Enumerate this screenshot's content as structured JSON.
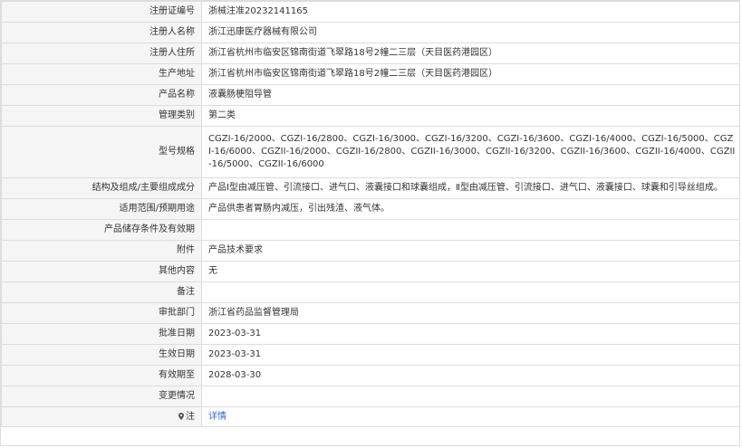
{
  "rows": [
    {
      "label": "注册证编号",
      "value": "浙械注准20232141165"
    },
    {
      "label": "注册人名称",
      "value": "浙江迅康医疗器械有限公司"
    },
    {
      "label": "注册人住所",
      "value": "浙江省杭州市临安区锦南街道飞翠路18号2幢二三层（天目医药港园区）"
    },
    {
      "label": "生产地址",
      "value": "浙江省杭州市临安区锦南街道飞翠路18号2幢二三层（天目医药港园区）"
    },
    {
      "label": "产品名称",
      "value": "液囊肠梗阻导管"
    },
    {
      "label": "管理类别",
      "value": "第二类"
    },
    {
      "label": "型号规格",
      "value": "CGZI-16/2000、CGZI-16/2800、CGZI-16/3000、CGZI-16/3200、CGZI-16/3600、CGZI-16/4000、CGZI-16/5000、CGZI-16/6000、CGZII-16/2000、CGZII-16/2800、CGZII-16/3000、CGZII-16/3200、CGZII-16/3600、CGZII-16/4000、CGZII-16/5000、CGZII-16/6000"
    },
    {
      "label": "结构及组成/主要组成成分",
      "value": "产品Ⅰ型由减压管、引流接口、进气口、液囊接口和球囊组成，Ⅱ型由减压管、引流接口、进气口、液囊接口、球囊和引导丝组成。"
    },
    {
      "label": "适用范围/预期用途",
      "value": "产品供患者胃肠内减压，引出残渣、液气体。"
    },
    {
      "label": "产品储存条件及有效期",
      "value": ""
    },
    {
      "label": "附件",
      "value": "产品技术要求"
    },
    {
      "label": "其他内容",
      "value": "无"
    },
    {
      "label": "备注",
      "value": ""
    },
    {
      "label": "审批部门",
      "value": "浙江省药品监督管理局"
    },
    {
      "label": "批准日期",
      "value": "2023-03-31"
    },
    {
      "label": "生效日期",
      "value": "2023-03-31"
    },
    {
      "label": "有效期至",
      "value": "2028-03-30"
    },
    {
      "label": "变更情况",
      "value": ""
    }
  ],
  "note_row": {
    "label": "注",
    "link": "详情",
    "icon": "map-pin-icon"
  },
  "colors": {
    "border": "#dddddd",
    "label_bg": "#f5f5f5",
    "link": "#3366cc",
    "text": "#333333"
  }
}
